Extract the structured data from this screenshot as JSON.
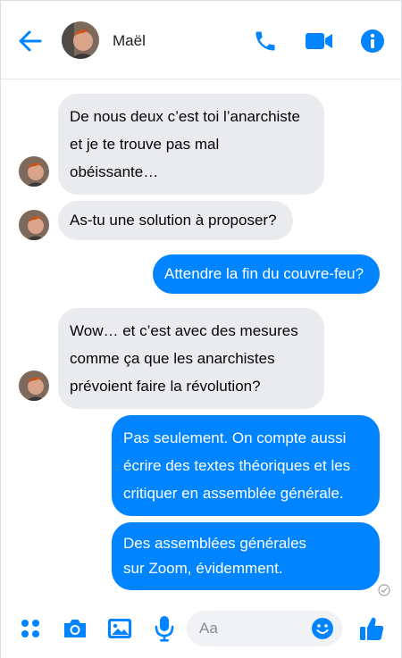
{
  "header": {
    "contact_name": "Maël",
    "icons": [
      "back-arrow-icon",
      "phone-icon",
      "video-camera-icon",
      "info-icon"
    ]
  },
  "messages": [
    {
      "direction": "incoming",
      "lines": [
        "De nous deux c’est toi l’anarchiste",
        "et je te trouve pas mal",
        "obéissante…"
      ]
    },
    {
      "direction": "incoming",
      "lines": [
        "As-tu une solution à proposer?"
      ]
    },
    {
      "direction": "outgoing",
      "lines": [
        "Attendre la fin du couvre-feu?"
      ]
    },
    {
      "direction": "incoming",
      "lines": [
        "Wow… et c’est avec des mesures",
        "comme ça que les anarchistes",
        "prévoient faire la révolution?"
      ]
    },
    {
      "direction": "outgoing",
      "lines": [
        "Pas seulement. On compte aussi",
        "écrire des textes théoriques et les",
        "critiquer en assemblée générale."
      ]
    },
    {
      "direction": "outgoing",
      "lines": [
        "Des assemblées générales",
        "sur Zoom, évidemment."
      ]
    }
  ],
  "composer": {
    "placeholder": "Aa",
    "icons": [
      "apps-icon",
      "camera-icon",
      "gallery-icon",
      "microphone-icon",
      "emoji-icon",
      "thumbs-up-icon"
    ]
  },
  "colors": {
    "accent": "#0084ff",
    "incoming_bubble": "#e9ebee",
    "outgoing_text": "#ffffff"
  }
}
